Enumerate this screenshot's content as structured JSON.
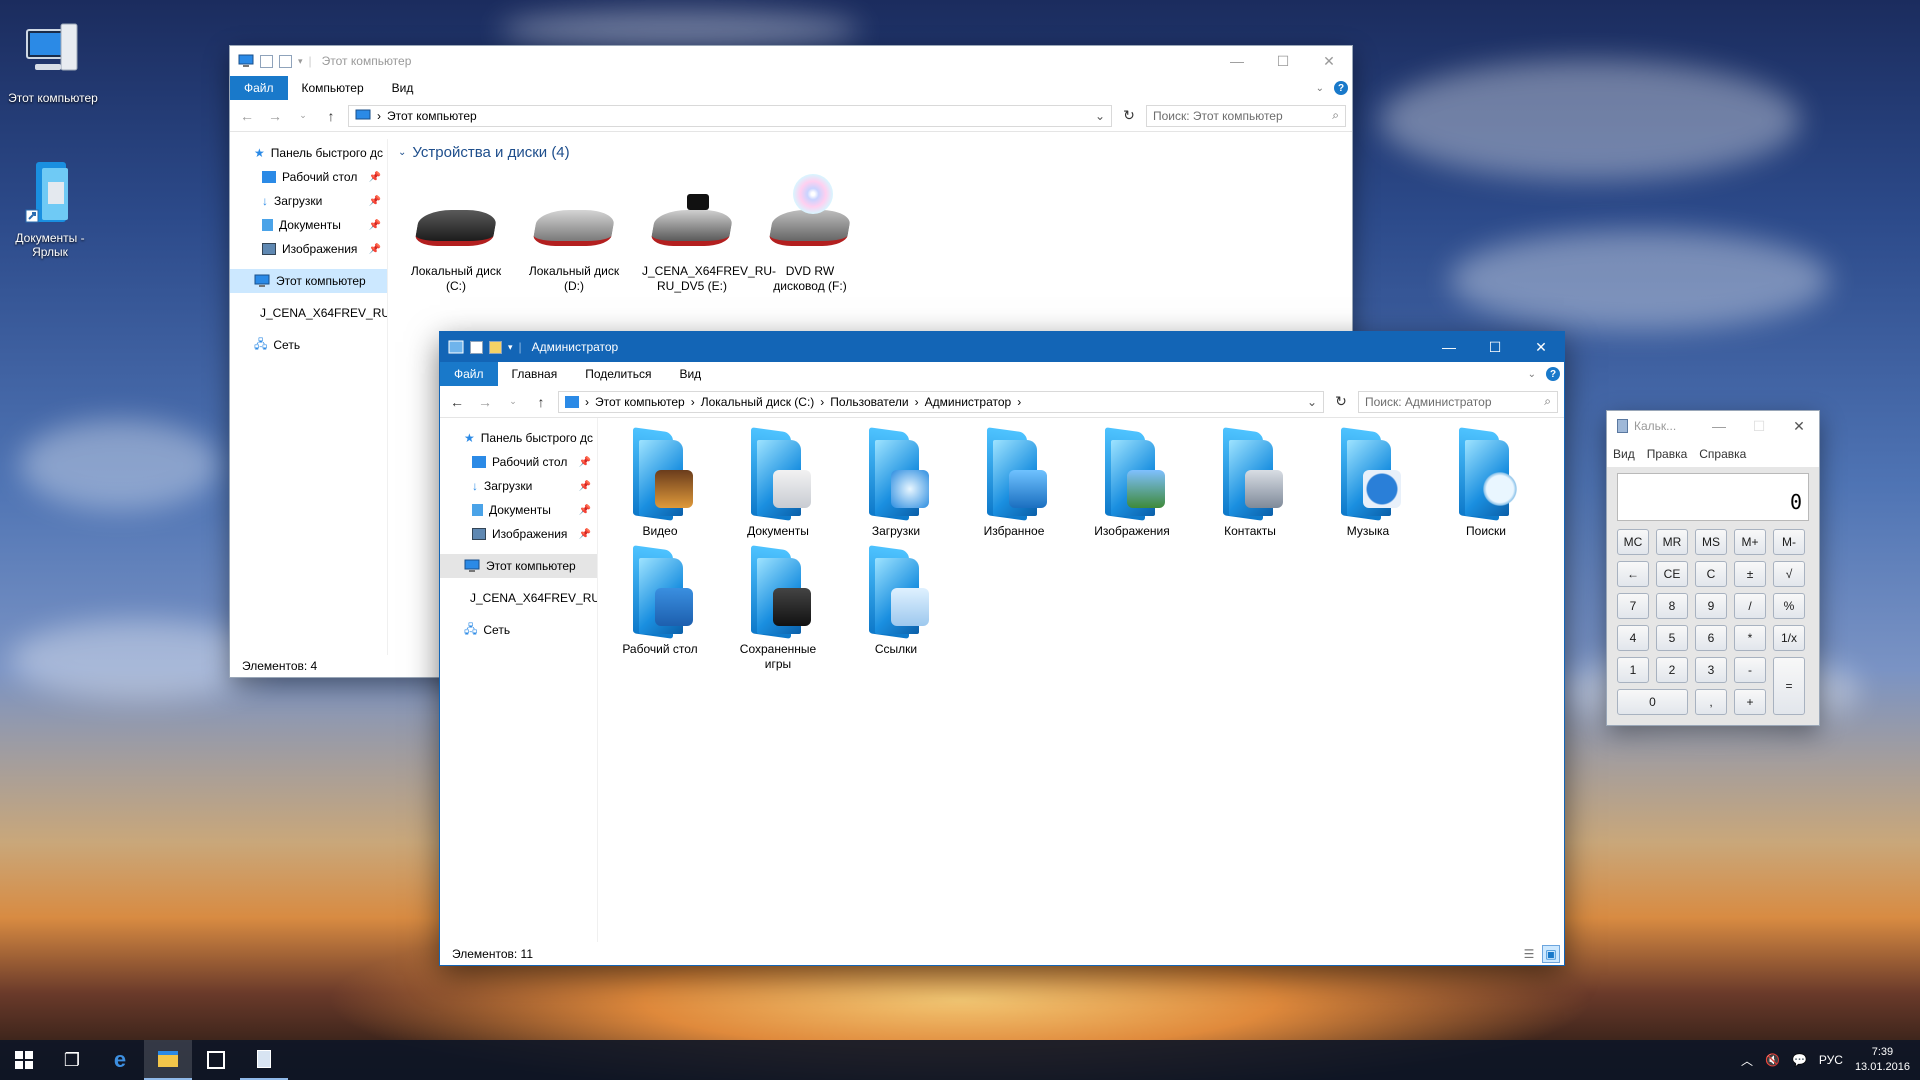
{
  "desktop": {
    "icons": [
      {
        "label": "Этот компьютер"
      },
      {
        "label": "Документы - Ярлык"
      }
    ]
  },
  "explorer_back": {
    "title": "Этот компьютер",
    "tabs": [
      "Файл",
      "Компьютер",
      "Вид"
    ],
    "address": "Этот компьютер",
    "search_placeholder": "Поиск: Этот компьютер",
    "nav": [
      {
        "label": "Панель быстрого дс",
        "pinned": false
      },
      {
        "label": "Рабочий стол",
        "pinned": true
      },
      {
        "label": "Загрузки",
        "pinned": true
      },
      {
        "label": "Документы",
        "pinned": true
      },
      {
        "label": "Изображения",
        "pinned": true
      },
      {
        "label": "Этот компьютер",
        "pinned": false
      },
      {
        "label": "J_CENA_X64FREV_RU",
        "pinned": false
      },
      {
        "label": "Сеть",
        "pinned": false
      }
    ],
    "group_title": "Устройства и диски (4)",
    "drives": [
      {
        "label": "Локальный диск (C:)"
      },
      {
        "label": "Локальный диск (D:)"
      },
      {
        "label": "J_CENA_X64FREV_RU-RU_DV5 (E:)"
      },
      {
        "label": "DVD RW дисковод (F:)"
      }
    ],
    "status": "Элементов: 4"
  },
  "explorer_front": {
    "title": "Администратор",
    "tabs": [
      "Файл",
      "Главная",
      "Поделиться",
      "Вид"
    ],
    "breadcrumb": [
      "Этот компьютер",
      "Локальный диск (C:)",
      "Пользователи",
      "Администратор"
    ],
    "search_placeholder": "Поиск: Администратор",
    "nav": [
      {
        "label": "Панель быстрого дс",
        "pinned": false
      },
      {
        "label": "Рабочий стол",
        "pinned": true
      },
      {
        "label": "Загрузки",
        "pinned": true
      },
      {
        "label": "Документы",
        "pinned": true
      },
      {
        "label": "Изображения",
        "pinned": true
      },
      {
        "label": "Этот компьютер",
        "pinned": false
      },
      {
        "label": "J_CENA_X64FREV_RU",
        "pinned": false
      },
      {
        "label": "Сеть",
        "pinned": false
      }
    ],
    "items": [
      {
        "label": "Видео",
        "emblem": "film-icon"
      },
      {
        "label": "Документы",
        "emblem": "document-icon"
      },
      {
        "label": "Загрузки",
        "emblem": "download-icon"
      },
      {
        "label": "Избранное",
        "emblem": "star-icon"
      },
      {
        "label": "Изображения",
        "emblem": "picture-icon"
      },
      {
        "label": "Контакты",
        "emblem": "contacts-icon"
      },
      {
        "label": "Музыка",
        "emblem": "play-icon"
      },
      {
        "label": "Поиски",
        "emblem": "magnifier-icon"
      },
      {
        "label": "Рабочий стол",
        "emblem": "desktop-icon"
      },
      {
        "label": "Сохраненные игры",
        "emblem": "joystick-icon"
      },
      {
        "label": "Ссылки",
        "emblem": "link-arrow-icon"
      }
    ],
    "status": "Элементов: 11"
  },
  "calculator": {
    "title": "Кальк...",
    "menu": [
      "Вид",
      "Правка",
      "Справка"
    ],
    "display": "0",
    "keys": [
      "MC",
      "MR",
      "MS",
      "M+",
      "M-",
      "←",
      "CE",
      "C",
      "±",
      "√",
      "7",
      "8",
      "9",
      "/",
      "%",
      "4",
      "5",
      "6",
      "*",
      "1/x",
      "1",
      "2",
      "3",
      "-",
      "=",
      "0",
      ",",
      "+"
    ]
  },
  "taskbar": {
    "language": "РУС",
    "time": "7:39",
    "date": "13.01.2016"
  },
  "colors": {
    "accent": "#1979ca",
    "active_titlebar": "#1365b6",
    "selection": "#cce8ff"
  }
}
